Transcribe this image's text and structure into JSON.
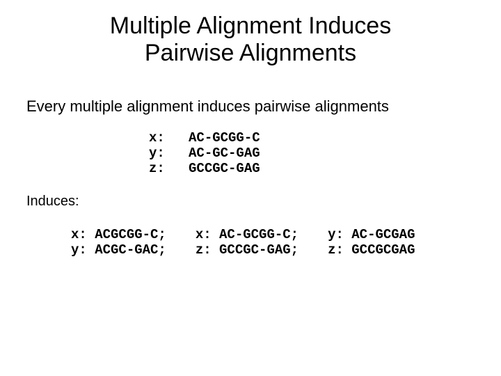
{
  "title_line1": "Multiple Alignment Induces",
  "title_line2": "Pairwise Alignments",
  "subtitle": "Every multiple alignment induces pairwise alignments",
  "msa": {
    "x": "x:   AC-GCGG-C",
    "y": "y:   AC-GC-GAG",
    "z": "z:   GCCGC-GAG"
  },
  "induces_label": "Induces:",
  "pairs": {
    "xy": "x: ACGCGG-C;\ny: ACGC-GAC;",
    "xz": "x: AC-GCGG-C;\nz: GCCGC-GAG;",
    "yz": "y: AC-GCGAG\nz: GCCGCGAG"
  }
}
